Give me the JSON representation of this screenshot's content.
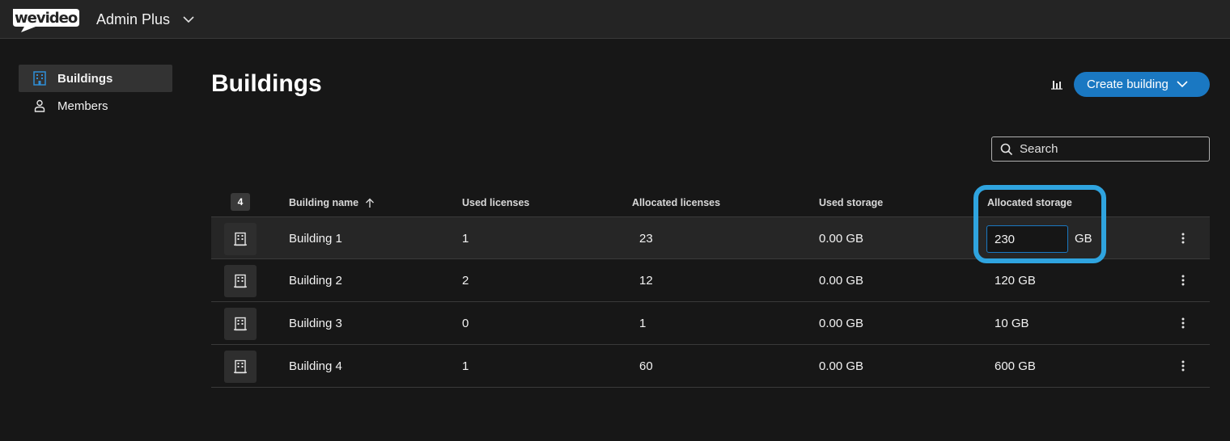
{
  "brand": {
    "logo_text": "wevideo",
    "workspace": "Admin Plus"
  },
  "sidebar": {
    "items": [
      {
        "label": "Buildings",
        "icon": "building-icon",
        "active": true
      },
      {
        "label": "Members",
        "icon": "person-icon",
        "active": false
      }
    ]
  },
  "main": {
    "title": "Buildings",
    "create_button": "Create building",
    "search_placeholder": "Search",
    "count": "4"
  },
  "table": {
    "headers": {
      "name": "Building name",
      "used_licenses": "Used licenses",
      "allocated_licenses": "Allocated licenses",
      "used_storage": "Used storage",
      "allocated_storage": "Allocated storage"
    },
    "rows": [
      {
        "name": "Building 1",
        "used_licenses": "1",
        "allocated_licenses": "23",
        "used_storage": "0.00  GB",
        "allocated_storage_value": "230",
        "allocated_storage_unit": "GB"
      },
      {
        "name": "Building 2",
        "used_licenses": "2",
        "allocated_licenses": "12",
        "used_storage": "0.00  GB",
        "allocated_storage": "120  GB"
      },
      {
        "name": "Building 3",
        "used_licenses": "0",
        "allocated_licenses": "1",
        "used_storage": "0.00  GB",
        "allocated_storage": "10  GB"
      },
      {
        "name": "Building 4",
        "used_licenses": "1",
        "allocated_licenses": "60",
        "used_storage": "0.00  GB",
        "allocated_storage": "600  GB"
      }
    ]
  },
  "colors": {
    "accent": "#1a78c2",
    "highlight": "#2fa4df",
    "background": "#171717"
  }
}
